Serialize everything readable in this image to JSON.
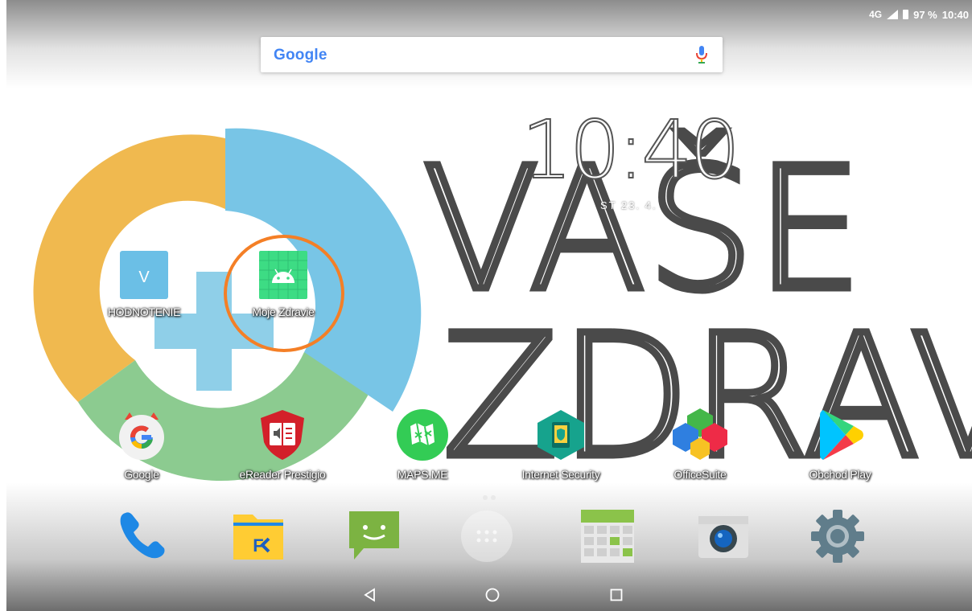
{
  "status_bar": {
    "network": "4G",
    "battery": "97 %",
    "time": "10:40"
  },
  "search": {
    "logo": "Google"
  },
  "clock_widget": {
    "time": "10:40",
    "date": "ST 23. 4."
  },
  "wallpaper": {
    "text_line1": "VAŠE",
    "text_line2": "ZDRAVOT"
  },
  "home_apps": [
    {
      "label": "HODNOTENIE",
      "icon": "v-letter-icon"
    },
    {
      "label": "Moje Zdravie",
      "icon": "android-icon"
    }
  ],
  "app_row": [
    {
      "label": "Google",
      "icon": "google-icon"
    },
    {
      "label": "eReader Prestigio",
      "icon": "ereader-icon"
    },
    {
      "label": "MAPS.ME",
      "icon": "maps-me-icon"
    },
    {
      "label": "Internet Security",
      "icon": "internet-security-icon"
    },
    {
      "label": "OfficeSuite",
      "icon": "officesuite-icon"
    },
    {
      "label": "Obchod Play",
      "icon": "play-store-icon"
    }
  ],
  "dock": [
    "phone-icon",
    "file-commander-icon",
    "messages-icon",
    "all-apps-icon",
    "calendar-icon",
    "camera-icon",
    "settings-icon"
  ],
  "colors": {
    "highlight": "#f47f26",
    "ring_blue": "#78c5e6",
    "ring_orange": "#f0b94f",
    "ring_green": "#8ccb90"
  }
}
